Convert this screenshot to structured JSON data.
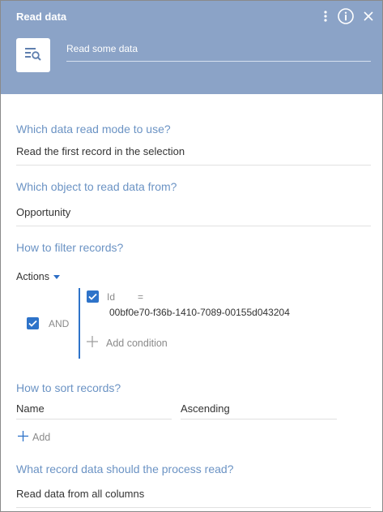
{
  "header": {
    "title": "Read data",
    "element_name": "Read some data",
    "icons": [
      "more-vert-icon",
      "info-icon",
      "close-icon",
      "read-data-icon"
    ]
  },
  "read_mode": {
    "question": "Which data read mode to use?",
    "value": "Read the first record in the selection"
  },
  "object": {
    "question": "Which object to read data from?",
    "value": "Opportunity"
  },
  "filter": {
    "question": "How to filter records?",
    "actions_label": "Actions",
    "group_label": "AND",
    "condition": {
      "field": "Id",
      "operator": "=",
      "value": "00bf0e70-f36b-1410-7089-00155d043204"
    },
    "add_condition_label": "Add condition"
  },
  "sort": {
    "question": "How to sort records?",
    "column": "Name",
    "direction": "Ascending",
    "add_label": "Add"
  },
  "columns": {
    "question": "What record data should the process read?",
    "value": "Read data from all columns"
  },
  "colors": {
    "header_bg": "#8ba3c7",
    "accent": "#2e73c9",
    "question_text": "#6b93c4"
  }
}
